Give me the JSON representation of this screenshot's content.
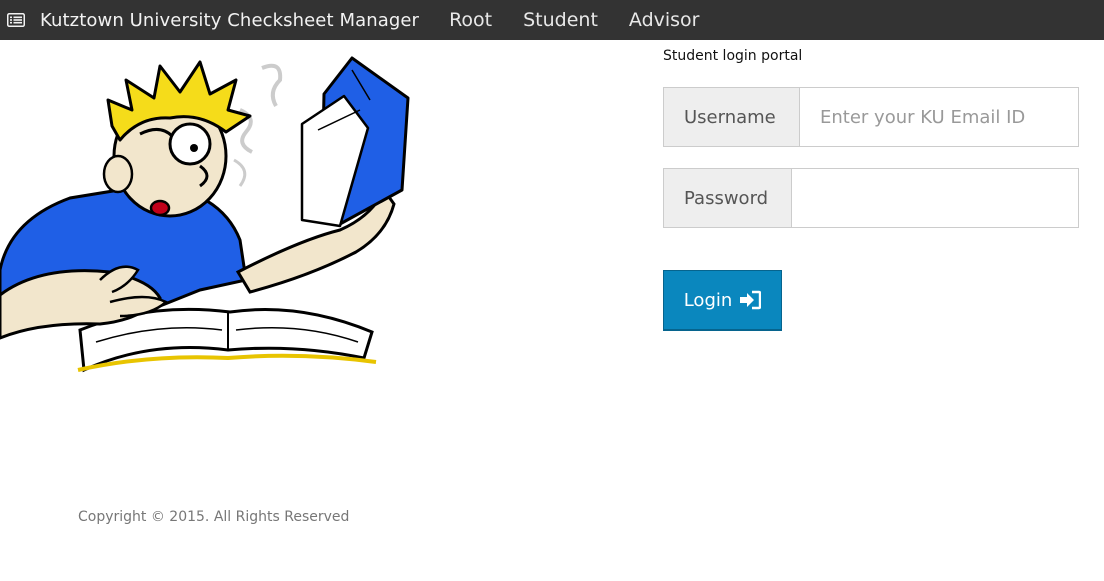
{
  "navbar": {
    "brand_icon": "list-icon",
    "brand": "Kutztown University Checksheet Manager",
    "links": [
      "Root",
      "Student",
      "Advisor"
    ]
  },
  "illustration": {
    "subject": "cartoon student reading a book"
  },
  "login": {
    "portal_title": "Student login portal",
    "username_label": "Username",
    "username_placeholder": "Enter your KU Email ID",
    "username_value": "",
    "password_label": "Password",
    "password_value": "",
    "button_label": "Login",
    "button_icon": "sign-in-icon"
  },
  "footer": {
    "copyright": "Copyright © 2015. All Rights Reserved"
  },
  "colors": {
    "navbar_bg": "#333333",
    "button_bg": "#0a87be",
    "addon_bg": "#eeeeee"
  }
}
